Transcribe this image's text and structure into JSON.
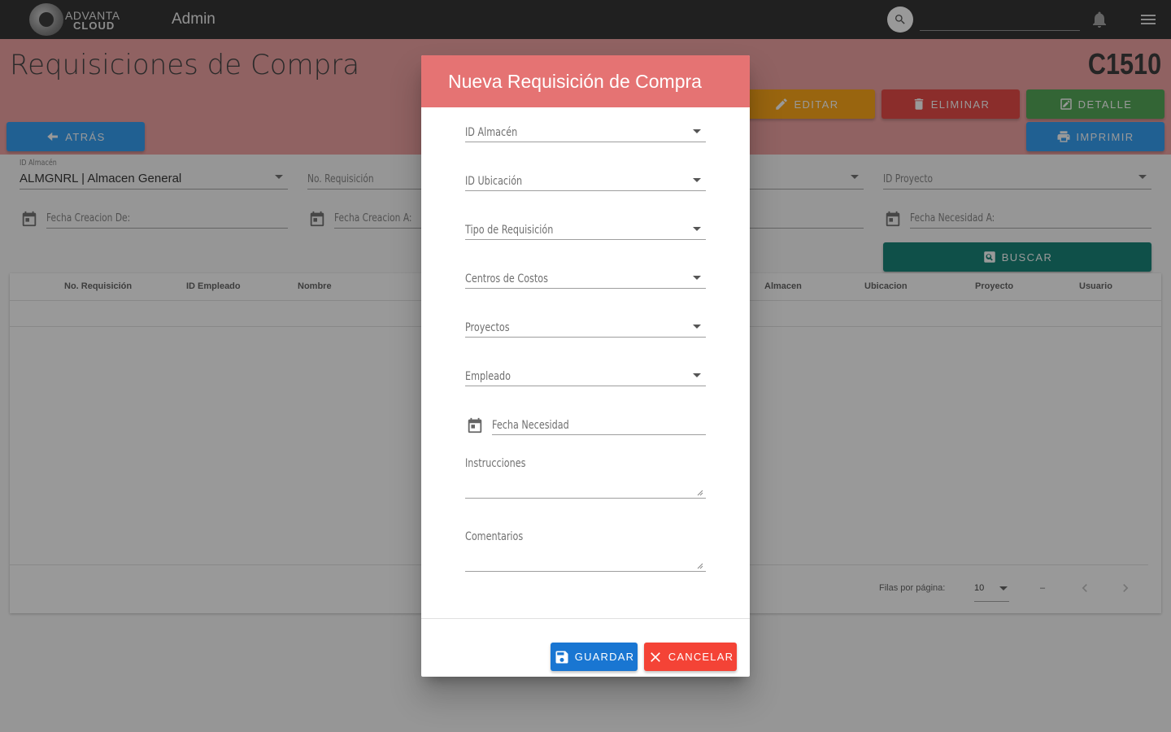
{
  "topbar": {
    "logo_line1": "ADVANTA",
    "logo_line2": "CLOUD",
    "section": "Admin",
    "search_placeholder": ""
  },
  "header": {
    "title": "Requisiciones de Compra",
    "code": "C1510",
    "buttons": {
      "back": "Atrás",
      "edit": "Editar",
      "delete": "Eliminar",
      "detail": "Detalle",
      "print": "Imprimir",
      "search": "Buscar"
    }
  },
  "filters": {
    "almacen_label": "ID Almacén",
    "almacen_value": "ALMGNRL | Almacen General",
    "requisicion_placeholder": "No. Requisición",
    "proyecto_placeholder": "ID Proyecto",
    "fecha_creacion_de": "Fecha Creacion De:",
    "fecha_creacion_a": "Fecha Creacion A:",
    "fecha_necesidad_a": "Fecha Necesidad A:"
  },
  "table": {
    "columns": [
      "No. Requisición",
      "ID Empleado",
      "Nombre",
      "Almacen",
      "Ubicacion",
      "Proyecto",
      "Usuario"
    ],
    "rows_per_page_label": "Filas por página:",
    "rows_per_page_value": "10",
    "range": "–"
  },
  "dialog": {
    "title": "Nueva Requisición de Compra",
    "fields": {
      "almacen": "ID Almacén",
      "ubicacion": "ID Ubicación",
      "tipo": "Tipo de Requisición",
      "centros": "Centros de Costos",
      "proyectos": "Proyectos",
      "empleado": "Empleado",
      "fecha_necesidad": "Fecha Necesidad",
      "instrucciones": "Instrucciones",
      "comentarios": "Comentarios"
    },
    "save": "Guardar",
    "cancel": "Cancelar"
  },
  "colors": {
    "topbar": "#212121",
    "header_band": "#ef9a9a",
    "dialog_header": "#e57373",
    "blue": "#2196f3",
    "orange": "#ffa000",
    "red": "#e53935",
    "green": "#43a047",
    "teal": "#00796b"
  },
  "icons": {
    "search": "search-icon",
    "bell": "bell-icon",
    "menu": "menu-icon",
    "calendar": "calendar-icon",
    "save": "save-icon",
    "close": "close-icon"
  }
}
